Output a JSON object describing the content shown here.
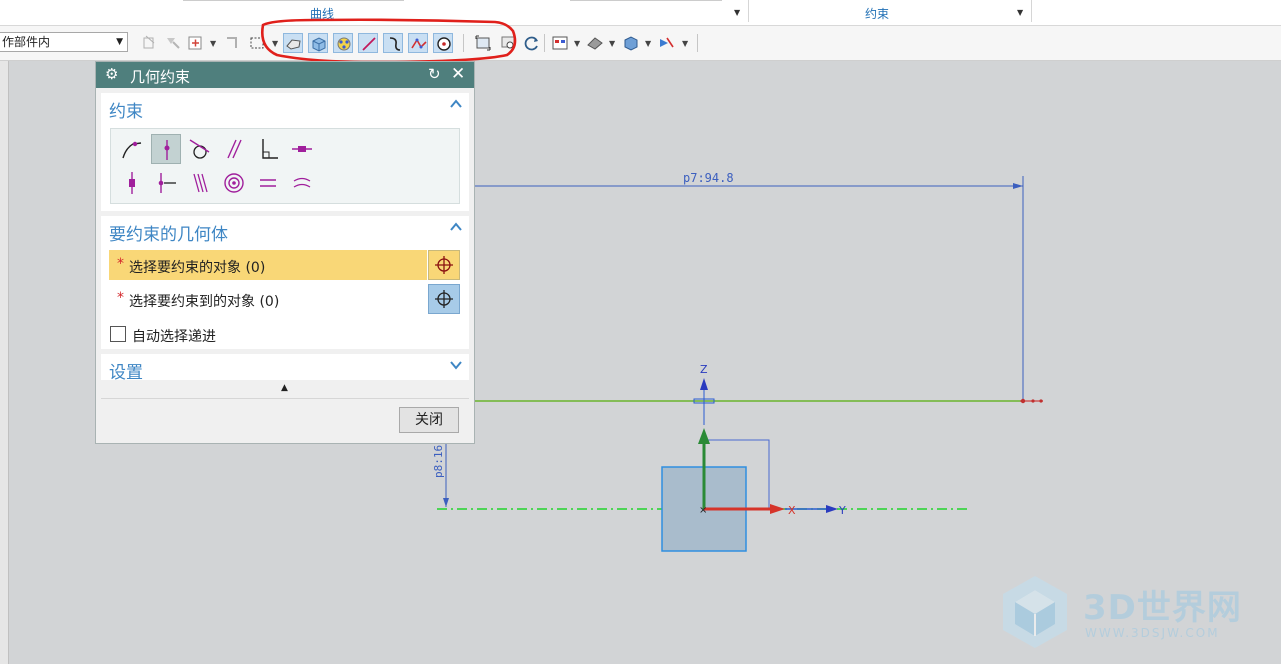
{
  "ribbon": {
    "groups": [
      {
        "label": "曲线"
      },
      {
        "label": "约束"
      }
    ]
  },
  "toolbar": {
    "scope_value": "作部件内"
  },
  "dialog": {
    "title": "几何约束",
    "constraint_section": {
      "title": "约束"
    },
    "constraint_icons": [
      "point-on-curve-icon",
      "point-on-line-icon",
      "tangent-icon",
      "parallel-icon",
      "perpendicular-icon",
      "horizontal-icon",
      "vertical-icon",
      "midpoint-icon",
      "collinear-icon",
      "concentric-icon",
      "equal-length-icon",
      "equal-radius-icon"
    ],
    "geometry_section": {
      "title": "要约束的几何体",
      "select_objects": "选择要约束的对象 (0)",
      "select_target": "选择要约束到的对象 (0)",
      "required_marker": "*",
      "auto_advance": "自动选择递进",
      "auto_advance_checked": false
    },
    "settings_section": {
      "title": "设置"
    },
    "close_label": "关闭"
  },
  "canvas": {
    "dimensions": [
      {
        "label": "p7:94.8"
      },
      {
        "label": "p8:16."
      }
    ],
    "axes": {
      "z": "Z",
      "x": "X",
      "y": "Y"
    }
  },
  "watermark": {
    "brand": "3D世界网",
    "url": "WWW.3DSJW.COM"
  },
  "colors": {
    "accent": "#3e86c4",
    "dialog_title_bg": "#4f7f7d",
    "active_row": "#f9d777",
    "sketch_line": "#6ab42d",
    "dimension": "#3c5fbf",
    "annotation": "#e0201b"
  }
}
